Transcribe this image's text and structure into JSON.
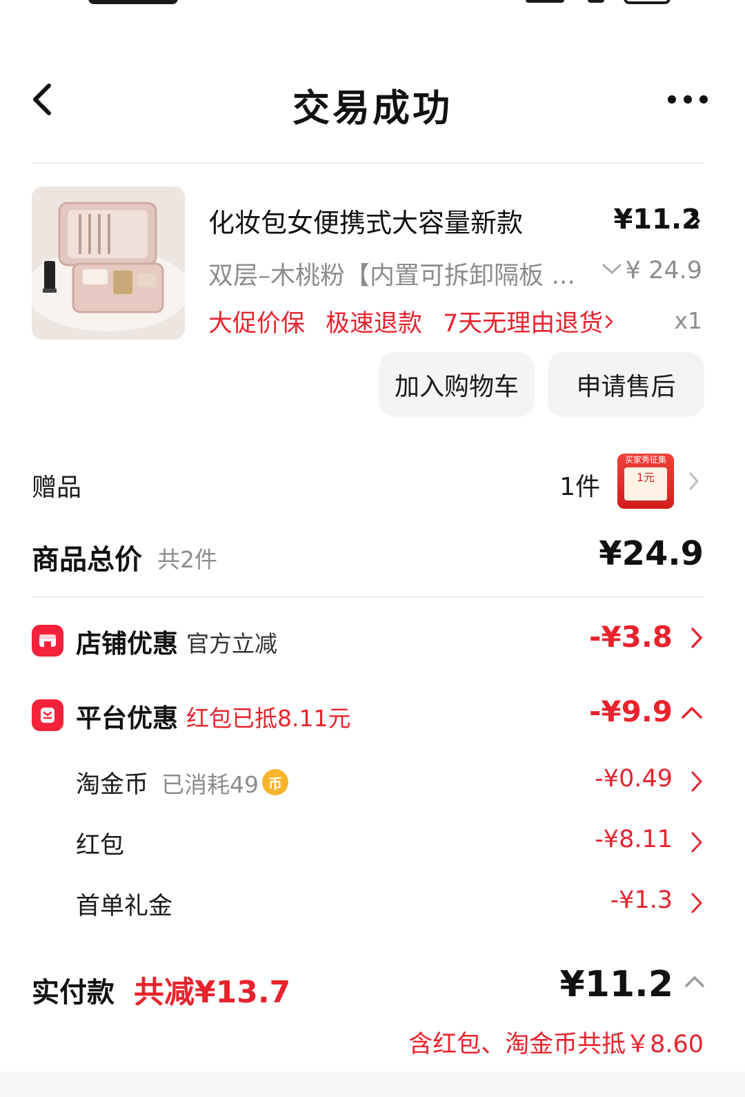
{
  "header": {
    "title": "交易成功"
  },
  "product": {
    "name": "化妆包女便携式大容量新款",
    "price": "¥11.2",
    "sku": "双层–木桃粉【内置可拆卸隔板 ...",
    "original_price": "¥ 24.9",
    "tags": [
      "大促价保",
      "极速退款",
      "7天无理由退货"
    ],
    "quantity": "x1",
    "image_icon": "cosmetic-bag-photo"
  },
  "actions": {
    "add_to_cart": "加入购物车",
    "after_sales": "申请售后"
  },
  "gift": {
    "label": "赠品",
    "count": "1件",
    "thumb_top": "买家秀征集",
    "thumb_card": "1元"
  },
  "total": {
    "label": "商品总价",
    "count": "共2件",
    "value": "¥24.9"
  },
  "discounts": {
    "shop": {
      "label": "店铺优惠",
      "sub": "官方立减",
      "value": "-¥3.8"
    },
    "platform": {
      "label": "平台优惠",
      "sub": "红包已抵8.11元",
      "value": "-¥9.9"
    }
  },
  "platform_items": [
    {
      "label": "淘金币",
      "note": "已消耗49",
      "coin": "币",
      "value": "-¥0.49"
    },
    {
      "label": "红包",
      "value": "-¥8.11"
    },
    {
      "label": "首单礼金",
      "value": "-¥1.3"
    }
  ],
  "paid": {
    "label": "实付款",
    "saved": "共减¥13.7",
    "value": "¥11.2",
    "note": "含红包、淘金币共抵￥8.60"
  },
  "colors": {
    "accent_red": "#e8232d",
    "muted_gray": "#8c8c8c",
    "button_bg": "#f2f4f6"
  }
}
